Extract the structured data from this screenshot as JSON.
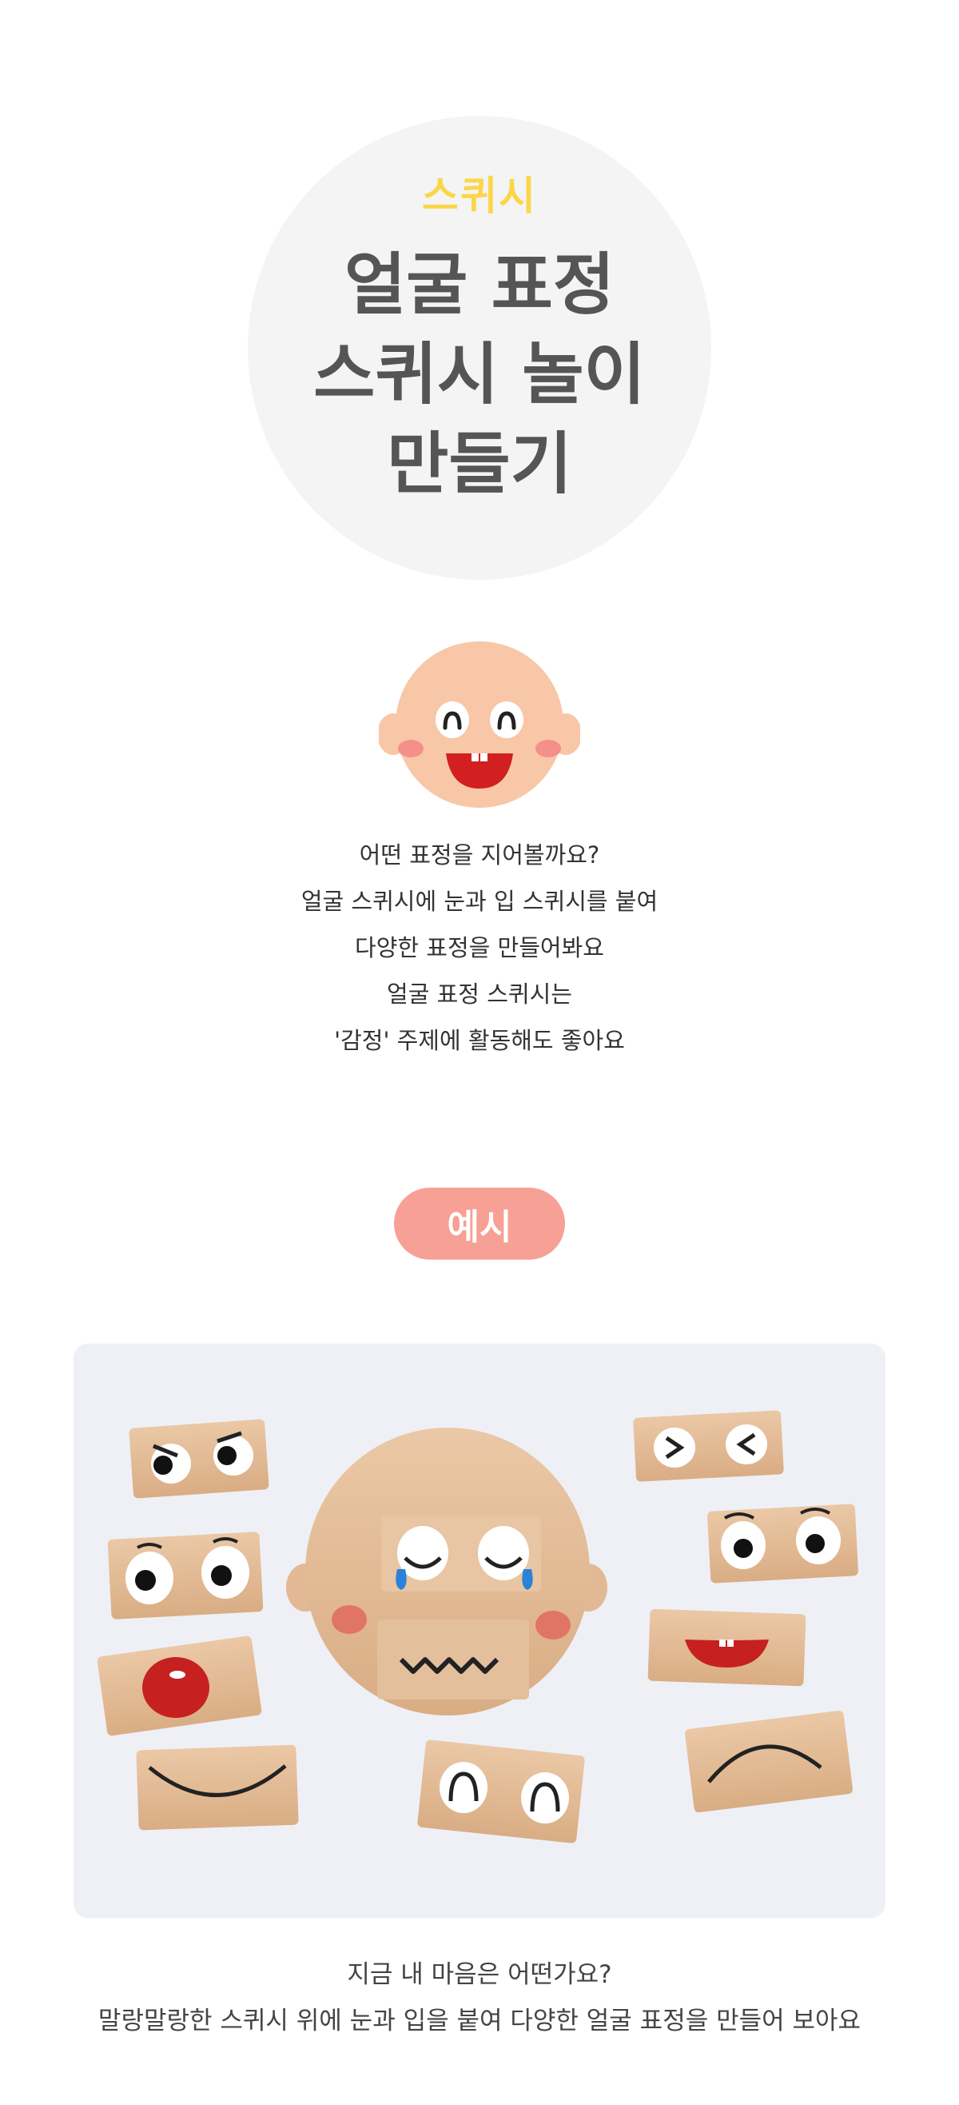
{
  "hero": {
    "subtitle": "스퀴시",
    "title_lines": [
      "얼굴 표정",
      "스퀴시 놀이",
      "만들기"
    ]
  },
  "description": {
    "lines": [
      "어떤 표정을 지어볼까요?",
      "얼굴 스퀴시에 눈과 입 스퀴시를 붙여",
      "다양한 표정을 만들어봐요",
      "얼굴 표정 스퀴시는",
      "'감정' 주제에 활동해도 좋아요"
    ]
  },
  "example": {
    "badge_label": "예시"
  },
  "caption": {
    "lines": [
      "지금 내 마음은 어떤가요?",
      "말랑말랑한 스퀴시 위에 눈과 입을 붙여 다양한 얼굴 표정을 만들어 보아요"
    ]
  },
  "colors": {
    "hero_circle": "#f4f4f4",
    "subtitle": "#fcd64a",
    "title": "#555555",
    "badge": "#f7a095",
    "face_skin": "#f8c7a8",
    "cheek": "#f58f8a",
    "mouth": "#d21f1f",
    "squishy": "#e2b994"
  },
  "icons": {
    "face": "smiling-baby-face-icon",
    "photo": "squishy-pieces-photo"
  }
}
